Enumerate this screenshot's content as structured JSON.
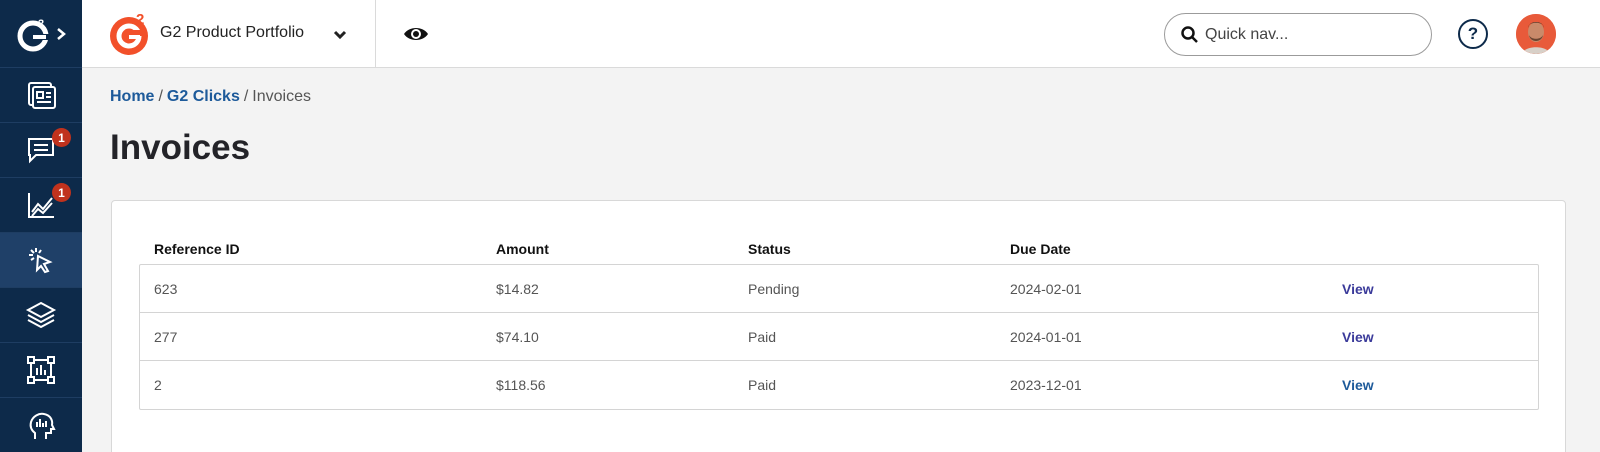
{
  "header": {
    "brand_name": "G2 Product Portfolio",
    "search_placeholder": "Quick nav..."
  },
  "sidebar": {
    "items": [
      {
        "icon": "dashboard-icon",
        "badge": ""
      },
      {
        "icon": "chat-icon",
        "badge": "1"
      },
      {
        "icon": "chart-icon",
        "badge": "1"
      },
      {
        "icon": "click-cursor-icon",
        "badge": ""
      },
      {
        "icon": "layers-icon",
        "badge": ""
      },
      {
        "icon": "report-icon",
        "badge": ""
      },
      {
        "icon": "insight-head-icon",
        "badge": ""
      }
    ]
  },
  "breadcrumb": {
    "home": "Home",
    "sep1": "/",
    "section": "G2 Clicks",
    "sep2": "/",
    "current": "Invoices"
  },
  "page": {
    "title": "Invoices"
  },
  "table": {
    "headers": [
      "Reference ID",
      "Amount",
      "Status",
      "Due Date"
    ],
    "rows": [
      {
        "ref": "623",
        "amount": "$14.82",
        "status": "Pending",
        "due": "2024-02-01",
        "action": "View"
      },
      {
        "ref": "277",
        "amount": "$74.10",
        "status": "Paid",
        "due": "2024-01-01",
        "action": "View"
      },
      {
        "ref": "2",
        "amount": "$118.56",
        "status": "Paid",
        "due": "2023-12-01",
        "action": "View"
      }
    ]
  },
  "colors": {
    "rail": "#0d2a4a",
    "brand_orange": "#f2502a",
    "link": "#1d5a9a",
    "badge": "#c0321d"
  }
}
